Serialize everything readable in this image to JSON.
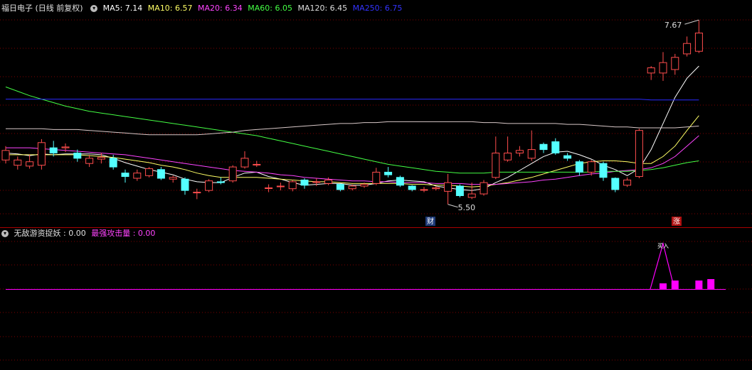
{
  "main_panel": {
    "title": "福日电子 (日线 前复权)",
    "ma_labels": [
      {
        "text": "MA5: 7.14",
        "color": "#ffffff"
      },
      {
        "text": "MA10: 6.57",
        "color": "#ffff66"
      },
      {
        "text": "MA20: 6.34",
        "color": "#ff44ff"
      },
      {
        "text": "MA60: 6.05",
        "color": "#44ff44"
      },
      {
        "text": "MA120: 6.45",
        "color": "#dddddd"
      },
      {
        "text": "MA250: 6.75",
        "color": "#3333ff"
      }
    ],
    "high_label": "7.67",
    "low_label": "5.50",
    "marker_cai": "财",
    "marker_zhang": "涨"
  },
  "sub_panel": {
    "name": "无敌游资捉妖",
    "value1": ": 0.00",
    "name2": "最强攻击量",
    "value2": ": 0.00",
    "peak_label": "买入"
  },
  "colors": {
    "up": "#ff4d4d",
    "down": "#54ffff",
    "grid": "#800000",
    "magenta": "#ff00ff"
  },
  "chart_data": {
    "type": "candlestick",
    "candles": [
      {
        "o": 6.06,
        "c": 6.17,
        "h": 6.22,
        "l": 6.02
      },
      {
        "o": 6.0,
        "c": 6.06,
        "h": 6.1,
        "l": 5.95
      },
      {
        "o": 5.99,
        "c": 6.04,
        "h": 6.12,
        "l": 5.96
      },
      {
        "o": 6.0,
        "c": 6.26,
        "h": 6.3,
        "l": 5.95
      },
      {
        "o": 6.2,
        "c": 6.14,
        "h": 6.28,
        "l": 6.1
      },
      {
        "o": 6.2,
        "c": 6.21,
        "h": 6.25,
        "l": 6.15
      },
      {
        "o": 6.14,
        "c": 6.08,
        "h": 6.18,
        "l": 6.04
      },
      {
        "o": 6.02,
        "c": 6.08,
        "h": 6.12,
        "l": 5.98
      },
      {
        "o": 6.07,
        "c": 6.09,
        "h": 6.14,
        "l": 6.02
      },
      {
        "o": 6.08,
        "c": 5.98,
        "h": 6.12,
        "l": 5.95
      },
      {
        "o": 5.91,
        "c": 5.87,
        "h": 5.95,
        "l": 5.8
      },
      {
        "o": 5.85,
        "c": 5.91,
        "h": 5.95,
        "l": 5.82
      },
      {
        "o": 5.88,
        "c": 5.96,
        "h": 5.98,
        "l": 5.86
      },
      {
        "o": 5.95,
        "c": 5.85,
        "h": 5.98,
        "l": 5.83
      },
      {
        "o": 5.84,
        "c": 5.86,
        "h": 5.88,
        "l": 5.8
      },
      {
        "o": 5.84,
        "c": 5.71,
        "h": 5.86,
        "l": 5.66
      },
      {
        "o": 5.69,
        "c": 5.69,
        "h": 5.73,
        "l": 5.61
      },
      {
        "o": 5.71,
        "c": 5.82,
        "h": 5.84,
        "l": 5.69
      },
      {
        "o": 5.81,
        "c": 5.8,
        "h": 5.86,
        "l": 5.78
      },
      {
        "o": 5.82,
        "c": 5.98,
        "h": 6.0,
        "l": 5.8
      },
      {
        "o": 5.98,
        "c": 6.08,
        "h": 6.16,
        "l": 5.96
      },
      {
        "o": 6.01,
        "c": 6.01,
        "h": 6.05,
        "l": 5.98
      },
      {
        "o": 5.74,
        "c": 5.74,
        "h": 5.78,
        "l": 5.69
      },
      {
        "o": 5.76,
        "c": 5.76,
        "h": 5.8,
        "l": 5.71
      },
      {
        "o": 5.73,
        "c": 5.81,
        "h": 5.83,
        "l": 5.7
      },
      {
        "o": 5.83,
        "c": 5.77,
        "h": 5.85,
        "l": 5.73
      },
      {
        "o": 5.81,
        "c": 5.81,
        "h": 5.85,
        "l": 5.76
      },
      {
        "o": 5.79,
        "c": 5.83,
        "h": 5.86,
        "l": 5.77
      },
      {
        "o": 5.78,
        "c": 5.72,
        "h": 5.79,
        "l": 5.7
      },
      {
        "o": 5.73,
        "c": 5.76,
        "h": 5.78,
        "l": 5.71
      },
      {
        "o": 5.76,
        "c": 5.78,
        "h": 5.8,
        "l": 5.74
      },
      {
        "o": 5.79,
        "c": 5.92,
        "h": 5.97,
        "l": 5.77
      },
      {
        "o": 5.92,
        "c": 5.89,
        "h": 5.98,
        "l": 5.86
      },
      {
        "o": 5.86,
        "c": 5.77,
        "h": 5.88,
        "l": 5.75
      },
      {
        "o": 5.76,
        "c": 5.72,
        "h": 5.77,
        "l": 5.7
      },
      {
        "o": 5.72,
        "c": 5.72,
        "h": 5.75,
        "l": 5.69
      },
      {
        "o": 5.73,
        "c": 5.74,
        "h": 5.76,
        "l": 5.71
      },
      {
        "o": 5.7,
        "c": 5.8,
        "h": 5.9,
        "l": 5.55
      },
      {
        "o": 5.76,
        "c": 5.65,
        "h": 5.78,
        "l": 5.63
      },
      {
        "o": 5.63,
        "c": 5.67,
        "h": 5.8,
        "l": 5.61
      },
      {
        "o": 5.67,
        "c": 5.8,
        "h": 5.83,
        "l": 5.65
      },
      {
        "o": 5.86,
        "c": 6.14,
        "h": 6.33,
        "l": 5.84
      },
      {
        "o": 6.06,
        "c": 6.14,
        "h": 6.33,
        "l": 6.04
      },
      {
        "o": 6.14,
        "c": 6.17,
        "h": 6.22,
        "l": 6.1
      },
      {
        "o": 6.08,
        "c": 6.18,
        "h": 6.4,
        "l": 6.05
      },
      {
        "o": 6.24,
        "c": 6.18,
        "h": 6.26,
        "l": 6.14
      },
      {
        "o": 6.27,
        "c": 6.14,
        "h": 6.31,
        "l": 6.12
      },
      {
        "o": 6.11,
        "c": 6.08,
        "h": 6.14,
        "l": 6.05
      },
      {
        "o": 6.04,
        "c": 5.92,
        "h": 6.06,
        "l": 5.88
      },
      {
        "o": 5.92,
        "c": 6.04,
        "h": 6.06,
        "l": 5.88
      },
      {
        "o": 6.02,
        "c": 5.86,
        "h": 6.04,
        "l": 5.82
      },
      {
        "o": 5.85,
        "c": 5.72,
        "h": 5.86,
        "l": 5.69
      },
      {
        "o": 5.77,
        "c": 5.83,
        "h": 5.86,
        "l": 5.75
      },
      {
        "o": 5.87,
        "c": 6.4,
        "h": 6.42,
        "l": 5.85
      },
      {
        "o": 7.06,
        "c": 7.12,
        "h": 7.14,
        "l": 6.98
      },
      {
        "o": 7.06,
        "c": 7.18,
        "h": 7.3,
        "l": 6.97
      },
      {
        "o": 7.1,
        "c": 7.24,
        "h": 7.28,
        "l": 7.04
      },
      {
        "o": 7.28,
        "c": 7.4,
        "h": 7.48,
        "l": 7.25
      },
      {
        "o": 7.31,
        "c": 7.52,
        "h": 7.67,
        "l": 7.29
      }
    ],
    "ylim": [
      5.45,
      7.72
    ],
    "ma": {
      "MA5": [
        6.14,
        6.13,
        6.11,
        6.13,
        6.12,
        6.13,
        6.13,
        6.13,
        6.12,
        6.08,
        6.03,
        5.99,
        5.95,
        5.92,
        5.89,
        5.84,
        5.81,
        5.8,
        5.8,
        5.86,
        5.91,
        5.92,
        5.87,
        5.84,
        5.8,
        5.77,
        5.78,
        5.79,
        5.79,
        5.77,
        5.77,
        5.79,
        5.82,
        5.83,
        5.82,
        5.81,
        5.76,
        5.74,
        5.72,
        5.71,
        5.73,
        5.8,
        5.86,
        5.94,
        6.02,
        6.1,
        6.15,
        6.16,
        6.12,
        6.07,
        6.0,
        5.95,
        5.88,
        5.96,
        6.18,
        6.48,
        6.78,
        7.0,
        7.14
      ],
      "MA10": [
        6.12,
        6.12,
        6.12,
        6.12,
        6.12,
        6.12,
        6.12,
        6.11,
        6.1,
        6.09,
        6.07,
        6.05,
        6.03,
        6.0,
        5.98,
        5.95,
        5.91,
        5.88,
        5.86,
        5.86,
        5.86,
        5.86,
        5.85,
        5.84,
        5.83,
        5.82,
        5.81,
        5.81,
        5.8,
        5.79,
        5.79,
        5.79,
        5.79,
        5.79,
        5.78,
        5.78,
        5.77,
        5.77,
        5.76,
        5.75,
        5.76,
        5.78,
        5.8,
        5.83,
        5.86,
        5.9,
        5.94,
        5.98,
        6.02,
        6.04,
        6.05,
        6.05,
        6.04,
        6.02,
        6.02,
        6.1,
        6.22,
        6.4,
        6.57
      ],
      "MA20": [
        6.2,
        6.2,
        6.2,
        6.19,
        6.18,
        6.17,
        6.16,
        6.15,
        6.14,
        6.13,
        6.12,
        6.1,
        6.08,
        6.06,
        6.04,
        6.02,
        6.0,
        5.98,
        5.96,
        5.94,
        5.93,
        5.92,
        5.91,
        5.89,
        5.88,
        5.86,
        5.85,
        5.84,
        5.83,
        5.82,
        5.82,
        5.81,
        5.81,
        5.8,
        5.8,
        5.8,
        5.79,
        5.79,
        5.79,
        5.78,
        5.78,
        5.78,
        5.79,
        5.8,
        5.81,
        5.83,
        5.84,
        5.86,
        5.88,
        5.9,
        5.91,
        5.93,
        5.94,
        5.95,
        5.97,
        6.02,
        6.1,
        6.22,
        6.34
      ],
      "MA60": [
        6.9,
        6.85,
        6.8,
        6.76,
        6.72,
        6.68,
        6.65,
        6.62,
        6.6,
        6.58,
        6.56,
        6.54,
        6.52,
        6.5,
        6.48,
        6.46,
        6.44,
        6.42,
        6.4,
        6.38,
        6.36,
        6.34,
        6.31,
        6.28,
        6.25,
        6.22,
        6.19,
        6.16,
        6.13,
        6.1,
        6.07,
        6.04,
        6.01,
        5.99,
        5.97,
        5.95,
        5.93,
        5.92,
        5.91,
        5.91,
        5.91,
        5.92,
        5.92,
        5.92,
        5.92,
        5.92,
        5.92,
        5.92,
        5.92,
        5.92,
        5.93,
        5.93,
        5.93,
        5.94,
        5.95,
        5.97,
        6.0,
        6.03,
        6.05
      ],
      "MA120": [
        6.42,
        6.42,
        6.42,
        6.42,
        6.41,
        6.41,
        6.41,
        6.4,
        6.39,
        6.38,
        6.37,
        6.36,
        6.35,
        6.35,
        6.35,
        6.35,
        6.35,
        6.36,
        6.37,
        6.38,
        6.4,
        6.41,
        6.42,
        6.43,
        6.44,
        6.45,
        6.46,
        6.47,
        6.48,
        6.48,
        6.49,
        6.49,
        6.5,
        6.5,
        6.5,
        6.5,
        6.5,
        6.5,
        6.5,
        6.5,
        6.49,
        6.49,
        6.48,
        6.48,
        6.48,
        6.48,
        6.48,
        6.47,
        6.47,
        6.46,
        6.45,
        6.44,
        6.44,
        6.43,
        6.43,
        6.43,
        6.43,
        6.44,
        6.45
      ],
      "MA250": [
        6.76,
        6.76,
        6.76,
        6.76,
        6.76,
        6.76,
        6.76,
        6.76,
        6.76,
        6.76,
        6.76,
        6.76,
        6.76,
        6.76,
        6.76,
        6.76,
        6.76,
        6.76,
        6.76,
        6.76,
        6.76,
        6.76,
        6.76,
        6.76,
        6.76,
        6.76,
        6.76,
        6.76,
        6.76,
        6.76,
        6.76,
        6.76,
        6.76,
        6.76,
        6.76,
        6.76,
        6.76,
        6.76,
        6.76,
        6.76,
        6.76,
        6.76,
        6.76,
        6.76,
        6.76,
        6.76,
        6.76,
        6.76,
        6.76,
        6.76,
        6.76,
        6.76,
        6.76,
        6.76,
        6.75,
        6.75,
        6.75,
        6.75,
        6.75
      ]
    },
    "indicator_bars": [
      {
        "index": 55,
        "value": 0.4
      },
      {
        "index": 56,
        "value": 0.6
      },
      {
        "index": 58,
        "value": 0.6
      },
      {
        "index": 59,
        "value": 0.7
      }
    ],
    "indicator_peak_index": 55
  }
}
